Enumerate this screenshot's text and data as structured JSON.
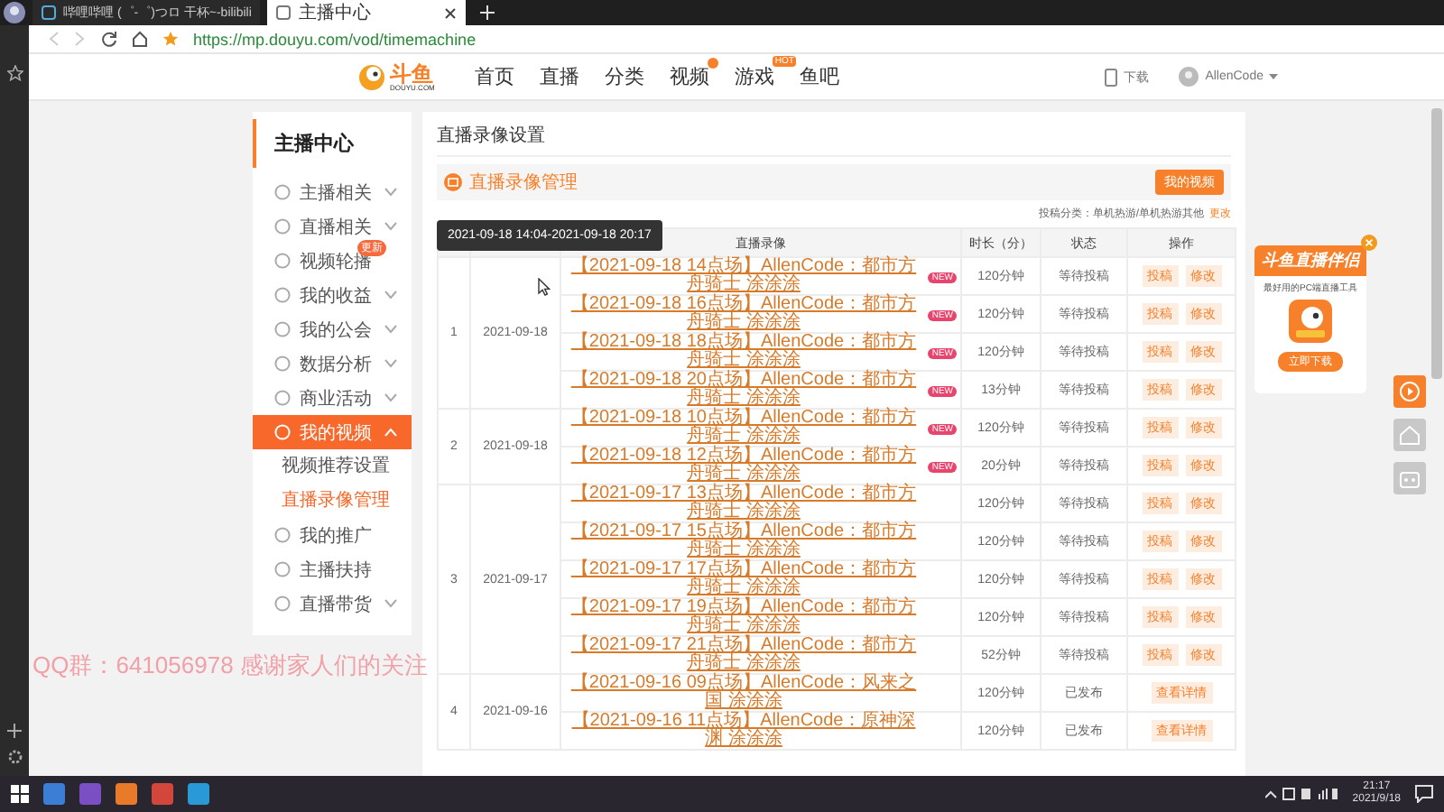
{
  "browser": {
    "tabs": [
      {
        "title": "哔哩哔哩 (゜-゜)つロ 干杯~-bilibili",
        "selected": false
      },
      {
        "title": "主播中心",
        "selected": true
      }
    ],
    "address": "https://mp.douyu.com/vod/timemachine"
  },
  "header": {
    "logo": "斗鱼",
    "logo_sub": "DOUYU.COM",
    "nav": [
      {
        "label": "首页",
        "dot": false
      },
      {
        "label": "直播",
        "dot": false
      },
      {
        "label": "分类",
        "dot": false
      },
      {
        "label": "视频",
        "dot": true
      },
      {
        "label": "游戏",
        "dot": false,
        "badge": "HOT"
      },
      {
        "label": "鱼吧",
        "dot": false
      }
    ],
    "download": "下载",
    "user": "AllenCode"
  },
  "sidebar": {
    "title": "主播中心",
    "items": [
      {
        "label": "主播相关",
        "kind": "group",
        "expanded": false,
        "selected": false
      },
      {
        "label": "直播相关",
        "kind": "group",
        "expanded": false,
        "selected": false
      },
      {
        "label": "视频轮播",
        "kind": "link",
        "selected": false,
        "badge": "更新"
      },
      {
        "label": "我的收益",
        "kind": "group",
        "expanded": false,
        "selected": false
      },
      {
        "label": "我的公会",
        "kind": "group",
        "expanded": false,
        "selected": false
      },
      {
        "label": "数据分析",
        "kind": "group",
        "expanded": false,
        "selected": false
      },
      {
        "label": "商业活动",
        "kind": "group",
        "expanded": false,
        "selected": false
      },
      {
        "label": "我的视频",
        "kind": "group",
        "expanded": true,
        "selected": true,
        "children": [
          {
            "label": "视频推荐设置",
            "selected": false
          },
          {
            "label": "直播录像管理",
            "selected": true
          }
        ]
      },
      {
        "label": "我的推广",
        "kind": "link",
        "selected": false
      },
      {
        "label": "主播扶持",
        "kind": "link",
        "selected": false
      },
      {
        "label": "直播带货",
        "kind": "group",
        "expanded": false,
        "selected": false
      }
    ]
  },
  "content": {
    "title": "直播录像设置",
    "section": "直播录像管理",
    "section_button": "我的视频",
    "category_label": "投稿分类：单机热游/单机热游其他",
    "category_link": "更改",
    "tooltip": "2021-09-18 14:04-2021-09-18 20:17",
    "table": {
      "columns": [
        "直播录像",
        "时长（分）",
        "状态",
        "操作"
      ],
      "groups": [
        {
          "index": "1",
          "date": "2021-09-18",
          "rows": [
            {
              "title": "【2021-09-18 14点场】AllenCode：都市方舟骑士 涂涂涂",
              "badge": "NEW",
              "duration": "120分钟",
              "status": "等待投稿",
              "actions": [
                "投稿",
                "修改"
              ]
            },
            {
              "title": "【2021-09-18 16点场】AllenCode：都市方舟骑士 涂涂涂",
              "badge": "NEW",
              "duration": "120分钟",
              "status": "等待投稿",
              "actions": [
                "投稿",
                "修改"
              ]
            },
            {
              "title": "【2021-09-18 18点场】AllenCode：都市方舟骑士 涂涂涂",
              "badge": "NEW",
              "duration": "120分钟",
              "status": "等待投稿",
              "actions": [
                "投稿",
                "修改"
              ]
            },
            {
              "title": "【2021-09-18 20点场】AllenCode：都市方舟骑士 涂涂涂",
              "badge": "NEW",
              "duration": "13分钟",
              "status": "等待投稿",
              "actions": [
                "投稿",
                "修改"
              ]
            }
          ]
        },
        {
          "index": "2",
          "date": "2021-09-18",
          "rows": [
            {
              "title": "【2021-09-18 10点场】AllenCode：都市方舟骑士 涂涂涂",
              "badge": "NEW",
              "duration": "120分钟",
              "status": "等待投稿",
              "actions": [
                "投稿",
                "修改"
              ]
            },
            {
              "title": "【2021-09-18 12点场】AllenCode：都市方舟骑士 涂涂涂",
              "badge": "NEW",
              "duration": "20分钟",
              "status": "等待投稿",
              "actions": [
                "投稿",
                "修改"
              ]
            }
          ]
        },
        {
          "index": "3",
          "date": "2021-09-17",
          "rows": [
            {
              "title": "【2021-09-17 13点场】AllenCode：都市方舟骑士 涂涂涂",
              "duration": "120分钟",
              "status": "等待投稿",
              "actions": [
                "投稿",
                "修改"
              ]
            },
            {
              "title": "【2021-09-17 15点场】AllenCode：都市方舟骑士 涂涂涂",
              "duration": "120分钟",
              "status": "等待投稿",
              "actions": [
                "投稿",
                "修改"
              ]
            },
            {
              "title": "【2021-09-17 17点场】AllenCode：都市方舟骑士 涂涂涂",
              "duration": "120分钟",
              "status": "等待投稿",
              "actions": [
                "投稿",
                "修改"
              ]
            },
            {
              "title": "【2021-09-17 19点场】AllenCode：都市方舟骑士 涂涂涂",
              "duration": "120分钟",
              "status": "等待投稿",
              "actions": [
                "投稿",
                "修改"
              ]
            },
            {
              "title": "【2021-09-17 21点场】AllenCode：都市方舟骑士 涂涂涂",
              "duration": "52分钟",
              "status": "等待投稿",
              "actions": [
                "投稿",
                "修改"
              ]
            }
          ]
        },
        {
          "index": "4",
          "date": "2021-09-16",
          "rows": [
            {
              "title": "【2021-09-16 09点场】AllenCode：风来之国 涂涂涂",
              "duration": "120分钟",
              "status": "已发布",
              "actions": [
                "查看详情"
              ]
            },
            {
              "title": "【2021-09-16 11点场】AllenCode：原神深渊 涂涂涂",
              "duration": "120分钟",
              "status": "已发布",
              "actions": [
                "查看详情"
              ]
            }
          ]
        }
      ]
    }
  },
  "promo": {
    "title": "斗鱼直播伴侣",
    "subtitle": "最好用的PC端直播工具",
    "button": "立即下载"
  },
  "overlay": "QQ群：641056978 感谢家人们的关注",
  "taskbar": {
    "time": "21:17",
    "date": "2021/9/18"
  }
}
